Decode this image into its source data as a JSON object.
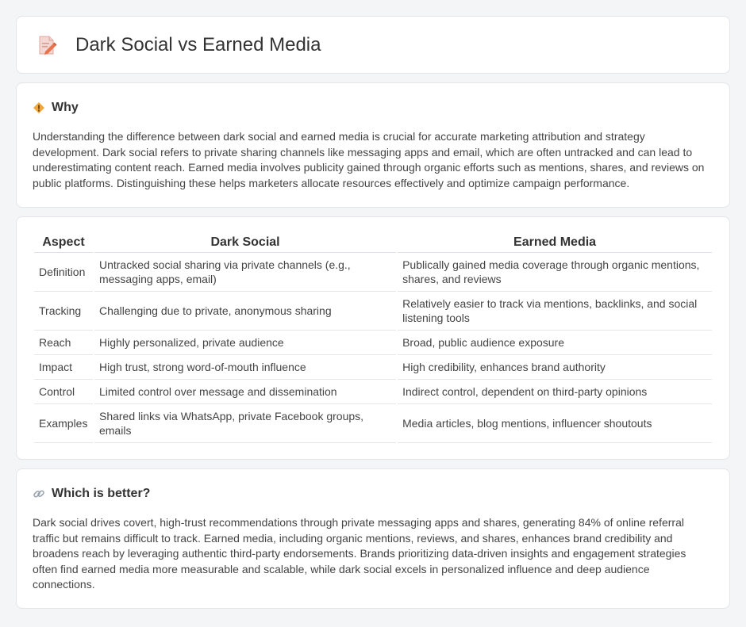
{
  "header": {
    "title": "Dark Social vs Earned Media",
    "icon": "document-pencil-icon"
  },
  "why": {
    "icon": "diamond-sign-icon",
    "title": "Why",
    "text": "Understanding the difference between dark social and earned media is crucial for accurate marketing attribution and strategy development. Dark social refers to private sharing channels like messaging apps and email, which are often untracked and can lead to underestimating content reach. Earned media involves publicity gained through organic efforts such as mentions, shares, and reviews on public platforms. Distinguishing these helps marketers allocate resources effectively and optimize campaign performance."
  },
  "table": {
    "headers": [
      "Aspect",
      "Dark Social",
      "Earned Media"
    ],
    "rows": [
      [
        "Definition",
        "Untracked social sharing via private channels (e.g., messaging apps, email)",
        "Publically gained media coverage through organic mentions, shares, and reviews"
      ],
      [
        "Tracking",
        "Challenging due to private, anonymous sharing",
        "Relatively easier to track via mentions, backlinks, and social listening tools"
      ],
      [
        "Reach",
        "Highly personalized, private audience",
        "Broad, public audience exposure"
      ],
      [
        "Impact",
        "High trust, strong word-of-mouth influence",
        "High credibility, enhances brand authority"
      ],
      [
        "Control",
        "Limited control over message and dissemination",
        "Indirect control, dependent on third-party opinions"
      ],
      [
        "Examples",
        "Shared links via WhatsApp, private Facebook groups, emails",
        "Media articles, blog mentions, influencer shoutouts"
      ]
    ]
  },
  "better": {
    "icon": "link-icon",
    "title": "Which is better?",
    "text": "Dark social drives covert, high-trust recommendations through private messaging apps and shares, generating 84% of online referral traffic but remains difficult to track. Earned media, including organic mentions, reviews, and shares, enhances brand credibility and broadens reach by leveraging authentic third-party endorsements. Brands prioritizing data-driven insights and engagement strategies often find earned media more measurable and scalable, while dark social excels in personalized influence and deep audience connections."
  }
}
